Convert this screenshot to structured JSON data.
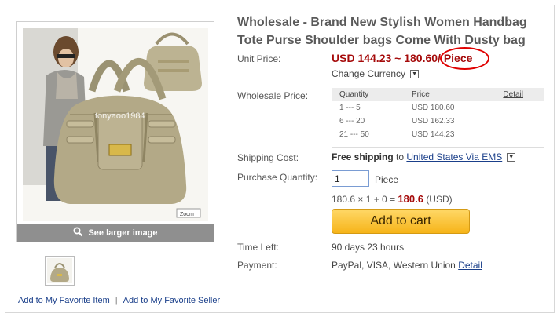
{
  "product": {
    "title": "Wholesale - Brand New Stylish Women Handbag Tote Purse Shoulder bags Come With Dusty bag",
    "watermark": "tonyaoo1984"
  },
  "gallery": {
    "see_larger_label": "See larger image",
    "photo_tag": "Zoom"
  },
  "favorites": {
    "item_label": "Add to My Favorite Item",
    "separator": "|",
    "seller_label": "Add to My Favorite Seller"
  },
  "pricing": {
    "unit_price_label": "Unit Price:",
    "unit_price_value": "USD 144.23 ~ 180.60",
    "unit_suffix": "/ Piece",
    "change_currency_label": "Change Currency",
    "wholesale_label": "Wholesale Price:",
    "table_headers": {
      "quantity": "Quantity",
      "price": "Price",
      "detail": "Detail"
    },
    "tiers": [
      {
        "quantity": "1 --- 5",
        "price": "USD 180.60"
      },
      {
        "quantity": "6 --- 20",
        "price": "USD 162.33"
      },
      {
        "quantity": "21 --- 50",
        "price": "USD 144.23"
      }
    ]
  },
  "shipping": {
    "label": "Shipping Cost:",
    "free_text": "Free shipping",
    "to_text": "to",
    "destination": "United States Via EMS"
  },
  "purchase": {
    "label": "Purchase Quantity:",
    "quantity_value": "1",
    "unit": "Piece",
    "calc_text": "180.6 × 1 + 0 =",
    "calc_total": "180.6",
    "calc_currency": "(USD)",
    "add_to_cart_label": "Add to cart"
  },
  "time_left": {
    "label": "Time Left:",
    "value": "90 days 23 hours"
  },
  "payment": {
    "label": "Payment:",
    "methods": "PayPal, VISA, Western Union",
    "detail_label": "Detail"
  },
  "colors": {
    "price_red": "#a50a0a",
    "link_blue": "#1a3f8a",
    "button_gold": "#f6b419",
    "circle_red": "#e00000"
  },
  "icons": [
    "magnifier-icon",
    "dropdown-arrow-icon"
  ]
}
